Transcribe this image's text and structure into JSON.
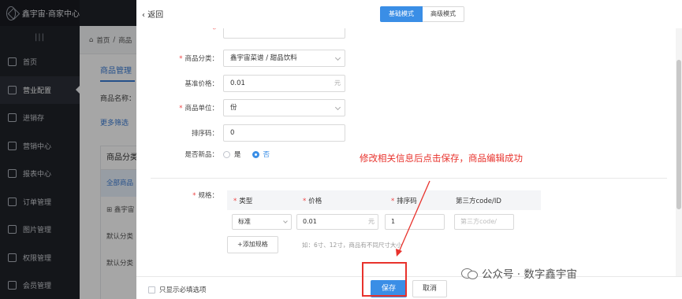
{
  "sidebar": {
    "brand": "鑫宇宙·商家中心",
    "collapse_glyph": "|||",
    "items": [
      {
        "label": "首页",
        "icon": "home-icon"
      },
      {
        "label": "营业配置",
        "icon": "store-icon"
      },
      {
        "label": "进销存",
        "icon": "inventory-icon"
      },
      {
        "label": "营销中心",
        "icon": "marketing-icon"
      },
      {
        "label": "报表中心",
        "icon": "report-icon"
      },
      {
        "label": "订单管理",
        "icon": "order-icon"
      },
      {
        "label": "图片管理",
        "icon": "image-icon"
      },
      {
        "label": "权限管理",
        "icon": "permission-icon"
      },
      {
        "label": "会员管理",
        "icon": "member-icon"
      }
    ]
  },
  "background_page": {
    "breadcrumb_home": "首页",
    "breadcrumb_next": "商品",
    "title": "商品管理",
    "field_label": "商品名称：",
    "more_filter": "更多筛选",
    "panel_title": "商品分类",
    "panel_rows": [
      "全部商品",
      "鑫宇宙",
      "默认分类",
      "默认分类"
    ]
  },
  "drawer": {
    "back_label": "返回",
    "modes": [
      "基础模式",
      "高级模式"
    ],
    "form": {
      "category": {
        "label": "商品分类：",
        "value": "鑫宇宙菜谱 / 甜品饮料"
      },
      "price": {
        "label": "基准价格：",
        "value": "0.01",
        "suffix": "元"
      },
      "unit": {
        "label": "商品单位：",
        "value": "份"
      },
      "sort": {
        "label": "排序码：",
        "value": "0"
      },
      "is_new": {
        "label": "是否新品：",
        "options": [
          "是",
          "否"
        ],
        "selected": "否"
      }
    },
    "spec": {
      "label": "规格：",
      "headers": [
        "类型",
        "价格",
        "排序码",
        "第三方code/ID"
      ],
      "row": {
        "type": "标准",
        "price": "0.01",
        "price_suffix": "元",
        "sort": "1",
        "code_placeholder": "第三方code/"
      },
      "add_label": "+添加规格",
      "hint": "如：6寸、12寸，商品有不同尺寸大小"
    },
    "annotation": "修改相关信息后点击保存，商品编辑成功",
    "footer": {
      "checkbox_label": "只显示必填选项",
      "save_label": "保存",
      "cancel_label": "取消"
    }
  },
  "watermark": "公众号 · 数字鑫宇宙",
  "colors": {
    "primary": "#3a8ee6",
    "annotation": "#e8322c",
    "sidebar_bg": "#1f2229"
  }
}
